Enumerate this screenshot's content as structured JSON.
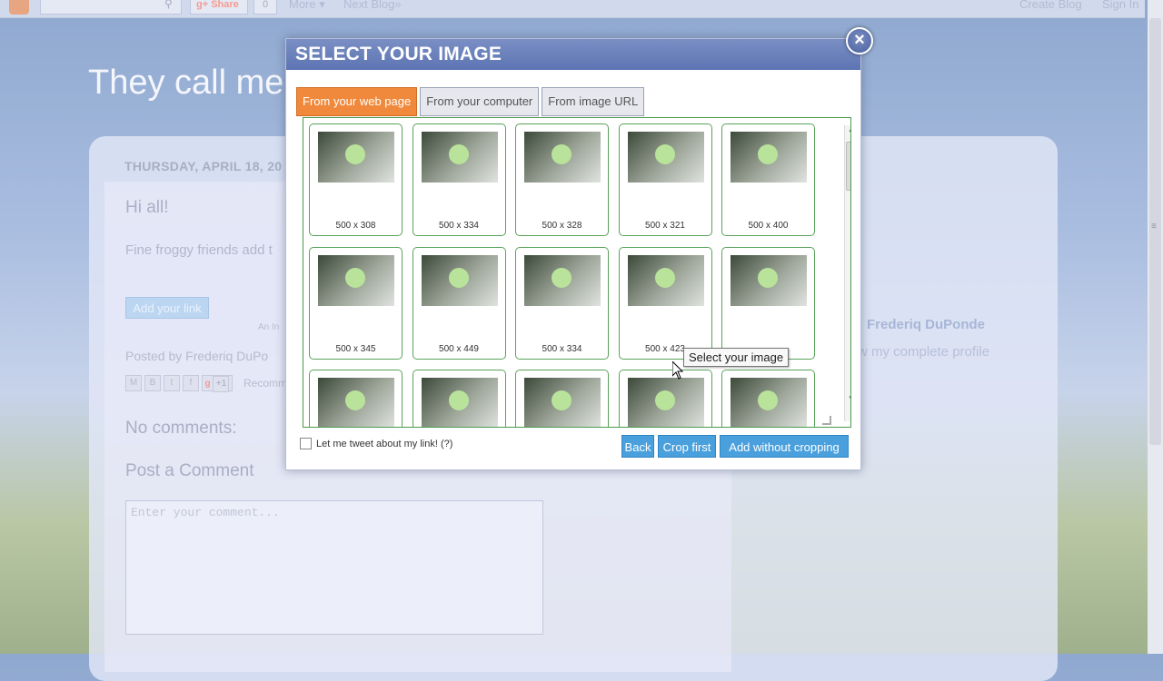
{
  "navbar": {
    "share": "Share",
    "count": "0",
    "more": "More",
    "next_blog": "Next Blog»",
    "create_blog": "Create Blog",
    "sign_in": "Sign In"
  },
  "blog": {
    "title": "They call me",
    "date": "THURSDAY, APRIL 18, 20",
    "greeting": "Hi all!",
    "body": "Fine froggy friends add t",
    "add_link_button": "Add your link",
    "an_in": "An In",
    "posted_by": "Posted by Frederiq DuPo",
    "recomm": "Recomm",
    "gplus": "+1",
    "no_comments": "No comments:",
    "post_comment": "Post a Comment",
    "comment_placeholder": "Enter your comment...",
    "author": "Frederiq DuPonde",
    "profile": "w my complete profile"
  },
  "dialog": {
    "title": "SELECT YOUR IMAGE",
    "tabs": [
      {
        "label": "From your web page",
        "active": true
      },
      {
        "label": "From your computer",
        "active": false
      },
      {
        "label": "From image URL",
        "active": false
      }
    ],
    "images": [
      {
        "size": "500 x 308"
      },
      {
        "size": "500 x 334"
      },
      {
        "size": "500 x 328"
      },
      {
        "size": "500 x 321"
      },
      {
        "size": "500 x 400"
      },
      {
        "size": "500 x 345"
      },
      {
        "size": "500 x 449"
      },
      {
        "size": "500 x 334"
      },
      {
        "size": "500 x 423"
      },
      {
        "size": ""
      },
      {
        "size": ""
      },
      {
        "size": ""
      },
      {
        "size": ""
      },
      {
        "size": ""
      },
      {
        "size": ""
      }
    ],
    "tooltip": "Select your image",
    "tweet_label": "Let me tweet about my link! (?)",
    "back_button": "Back",
    "crop_button": "Crop first",
    "add_button": "Add without cropping"
  },
  "colors": {
    "dialog_header": "#5d74b3",
    "active_tab": "#f0893c",
    "grid_border": "#4d9a4d",
    "button": "#4aa0dd"
  }
}
